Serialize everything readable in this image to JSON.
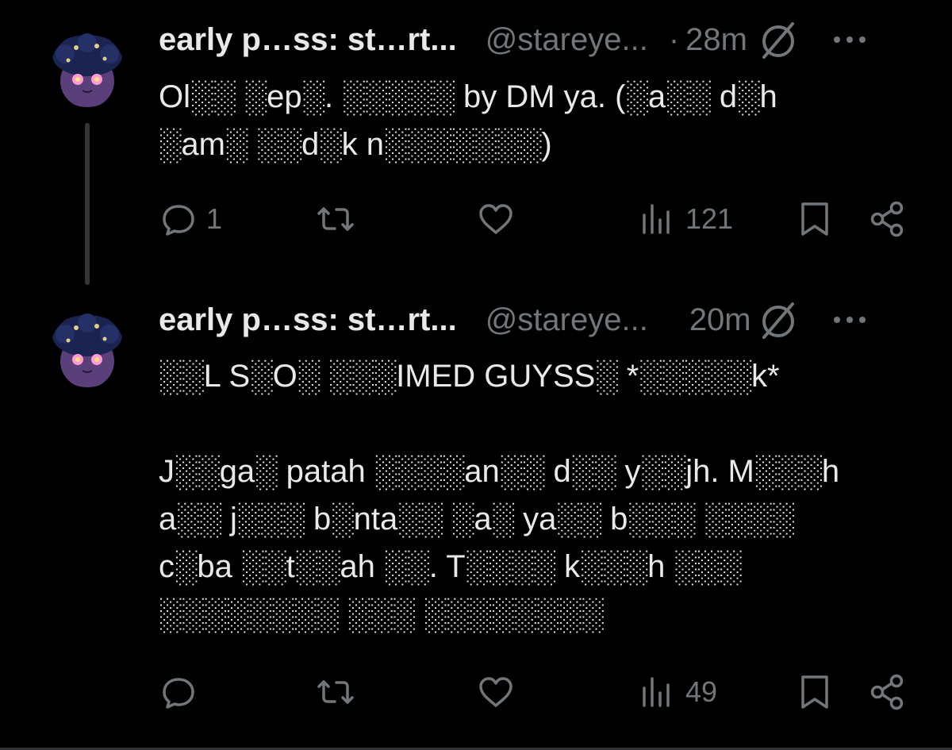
{
  "tweets": [
    {
      "display_name": "early p…ss: st…rt...",
      "handle": "@stareye...",
      "separator": "·",
      "time": "28m",
      "body": [
        "Ol░░ ░ep░. ░░░░░ by DM ya. (░a░░ d░h ░am░ ░░d░k n░░░░░░░)"
      ],
      "reply_count": "1",
      "retweet_count": "",
      "like_count": "",
      "view_count": "121"
    },
    {
      "display_name": "early p…ss: st…rt...",
      "handle": "@stareye...",
      "separator": "",
      "time": "20m",
      "body": [
        "░░L S░O░ ░░░IMED GUYSS░ *░░░░░k*",
        "J░░ga░ patah ░░░░an░░ d░░ y░░jh. M░░░h a░░ j░░░ b░nta░░ ░a░ ya░░ b░░░ ░░░░ c░ba ░░t░░ah ░░. T░░░░ k░░░h ░░░ ░░░░░░░░ ░░░ ░░░░░░░░"
      ],
      "reply_count": "",
      "retweet_count": "",
      "like_count": "",
      "view_count": "49"
    }
  ],
  "icons": {
    "reply": "reply-bubble-icon",
    "retweet": "retweet-icon",
    "like": "heart-icon",
    "views": "views-bar-chart-icon",
    "bookmark": "bookmark-icon",
    "share": "share-icon",
    "grok": "grok-slash-circle-icon",
    "more": "more-dots-icon"
  },
  "colors": {
    "background": "#000000",
    "text": "#e7e9ea",
    "secondary": "#71767b",
    "thread_line": "#333639"
  }
}
